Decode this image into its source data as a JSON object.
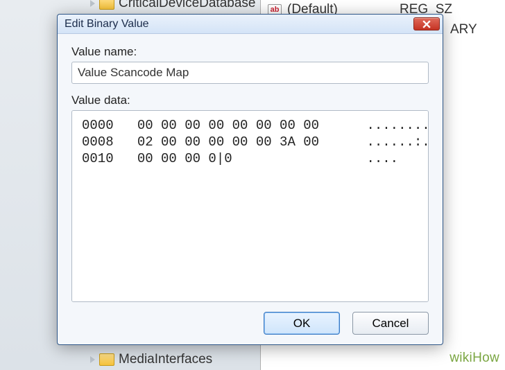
{
  "background": {
    "tree_item_top": "CriticalDeviceDatabase",
    "tree_item_bottom": "MediaInterfaces",
    "list": {
      "default_name": "(Default)",
      "default_type": "REG_SZ",
      "peek_type": "ARY"
    }
  },
  "dialog": {
    "title": "Edit Binary Value",
    "value_name_label": "Value name:",
    "value_name": "Value Scancode Map",
    "value_data_label": "Value data:",
    "hex_rows": [
      {
        "offset": "0000",
        "bytes": "00 00 00 00 00 00 00 00",
        "ascii": "........"
      },
      {
        "offset": "0008",
        "bytes": "02 00 00 00 00 00 3A 00",
        "ascii": "......:."
      },
      {
        "offset": "0010",
        "bytes": "00 00 00 0|0",
        "ascii": "...."
      }
    ],
    "ok": "OK",
    "cancel": "Cancel"
  },
  "watermark": "wikiHow"
}
